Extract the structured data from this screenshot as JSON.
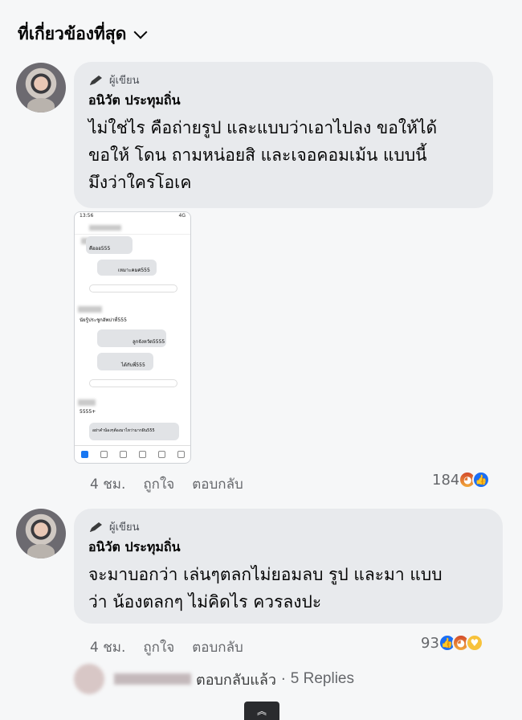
{
  "header": {
    "sort_label": "ที่เกี่ยวข้องที่สุด"
  },
  "comments": [
    {
      "badge": "ผู้เขียน",
      "author": "อนิวัต ประทุมถิ่น",
      "lines": [
        "ไม่ใช่ไร คือถ่ายรูป และแบบว่าเอาไปลง ขอให้ได้",
        "ขอให้ โดน ถามหน่อยสิ และเจอคอมเม้น แบบนี้",
        "มึงว่าใครโอเค"
      ],
      "time": "4 ชม.",
      "like": "ถูกใจ",
      "reply": "ตอบกลับ",
      "reaction_count": "184",
      "reactions": [
        "angry-icon",
        "like-icon"
      ]
    },
    {
      "badge": "ผู้เขียน",
      "author": "อนิวัต ประทุมถิ่น",
      "lines": [
        "จะมาบอกว่า เล่นๆตลกไม่ยอมลบ รูป และมา แบบ",
        "ว่า น้องตลกๆ ไม่คิดไร ควรลงปะ"
      ],
      "time": "4 ชม.",
      "like": "ถูกใจ",
      "reply": "ตอบกลับ",
      "reaction_count": "93",
      "reactions": [
        "like-icon",
        "angry-icon",
        "care-icon"
      ]
    }
  ],
  "attachment": {
    "status_time": "13:56",
    "status_signal": "4G",
    "rows": [
      "คือออ555",
      "เหมาะคมศ555",
      "นัยรู้ประชูกอัพบ่าที่555",
      "ลูกจังหวัด5555",
      "ได้กับพี่555",
      "5555+",
      "อย่าคำน้องๆต้องมาไหว่ามากฝัน555"
    ]
  },
  "replies_summary": {
    "action": "ตอบกลับแล้ว",
    "separator": "·",
    "count": "5 Replies"
  },
  "colors": {
    "bubble": "#e8eaed",
    "background": "#f6f7f8",
    "like_blue": "#1a6ef5"
  }
}
